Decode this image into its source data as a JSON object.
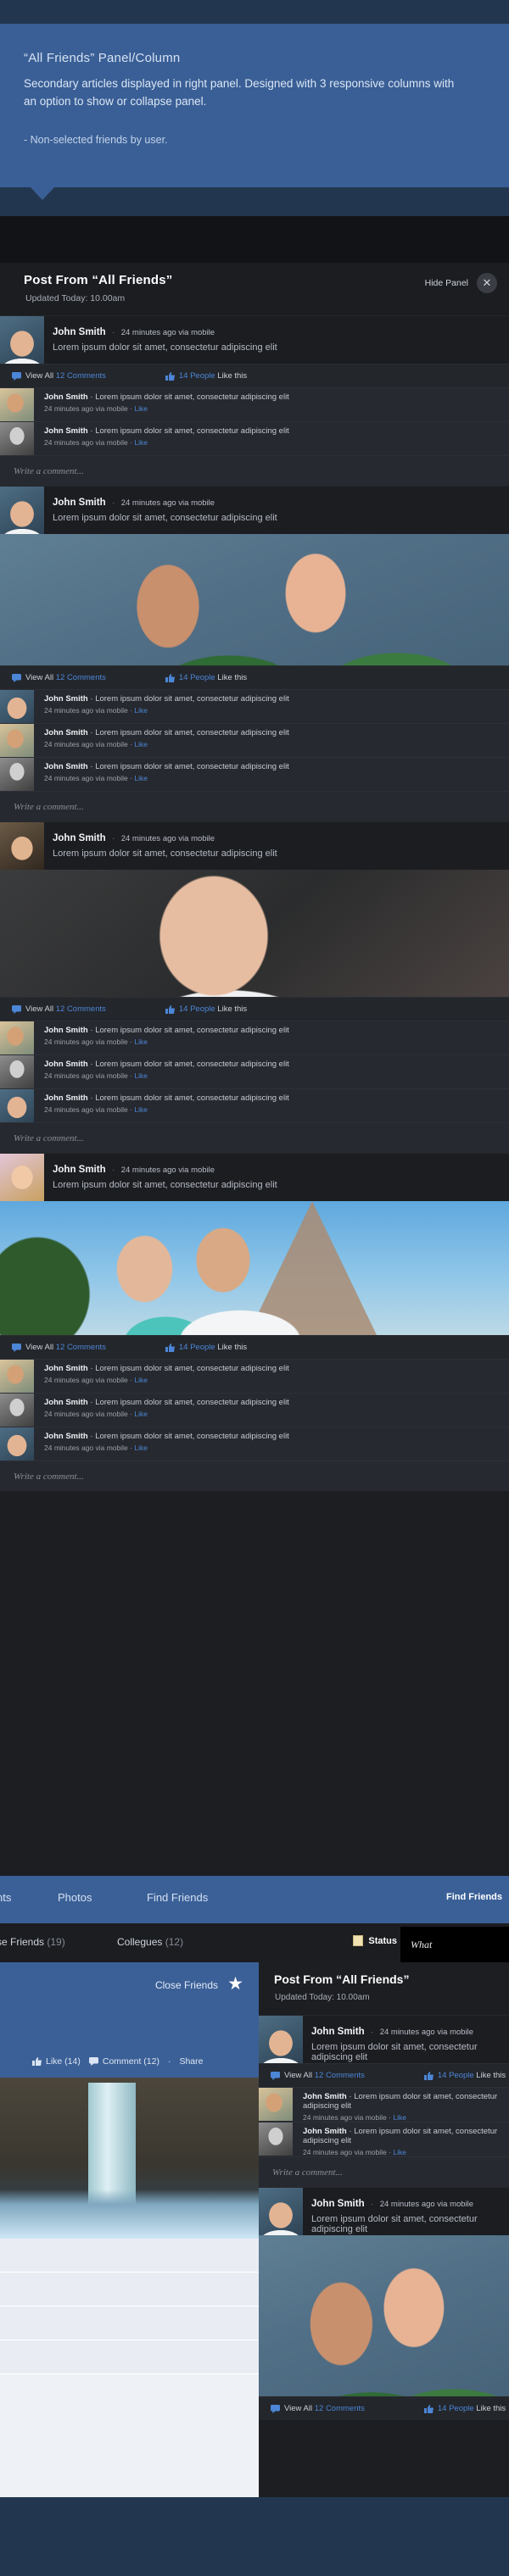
{
  "annotation": {
    "title": "“All Friends” Panel/Column",
    "body": "Secondary articles displayed in right panel. Designed with 3 responsive columns with an option to show or collapse panel.",
    "note": "- Non-selected friends by user."
  },
  "panel": {
    "title": "Post From “All Friends”",
    "subtitle": "Updated Today: 10.00am",
    "hide_label": "Hide Panel",
    "close_glyph": "✕"
  },
  "story": {
    "name": "John Smith",
    "separator": "·",
    "time": "24 minutes ago via mobile",
    "text": "Lorem ipsum dolor sit amet, consectetur adipiscing elit"
  },
  "actions": {
    "comments_prefix": "View All ",
    "comments_count": "12 Comments",
    "likes_count": "14 People",
    "likes_suffix": " Like this"
  },
  "comment": {
    "name": "John Smith",
    "separator": "·",
    "text": "Lorem ipsum dolor sit amet, consectetur adipiscing elit",
    "time": "24 minutes ago via mobile",
    "dot": "·",
    "like": "Like"
  },
  "composer": {
    "placeholder": "Write a comment..."
  },
  "lower": {
    "nav_items": [
      "nts",
      "Photos",
      "Find Friends"
    ],
    "nav_right": "Find Friends",
    "sub_items": [
      {
        "label": "se Friends",
        "count": "(19)"
      },
      {
        "label": "Collegues",
        "count": "(12)"
      }
    ],
    "status_label": "Status",
    "status_placeholder": "What",
    "close_friends_label": "Close Friends",
    "star_glyph": "★",
    "like_label": "Like (14)",
    "comment_label": "Comment (12)",
    "share_sep": "·",
    "share_label": "Share"
  },
  "icons": {
    "comment_bubble": "comment-bubble-icon",
    "thumbs_up": "thumbs-up-icon",
    "star": "star-icon",
    "status_note": "note-icon",
    "close": "close-icon"
  },
  "colors": {
    "brand_blue": "#3b6097",
    "dark_blue": "#22374f",
    "panel_bg": "#1c1e22",
    "comment_bg": "#26292f",
    "link_blue": "#4c86d6"
  }
}
